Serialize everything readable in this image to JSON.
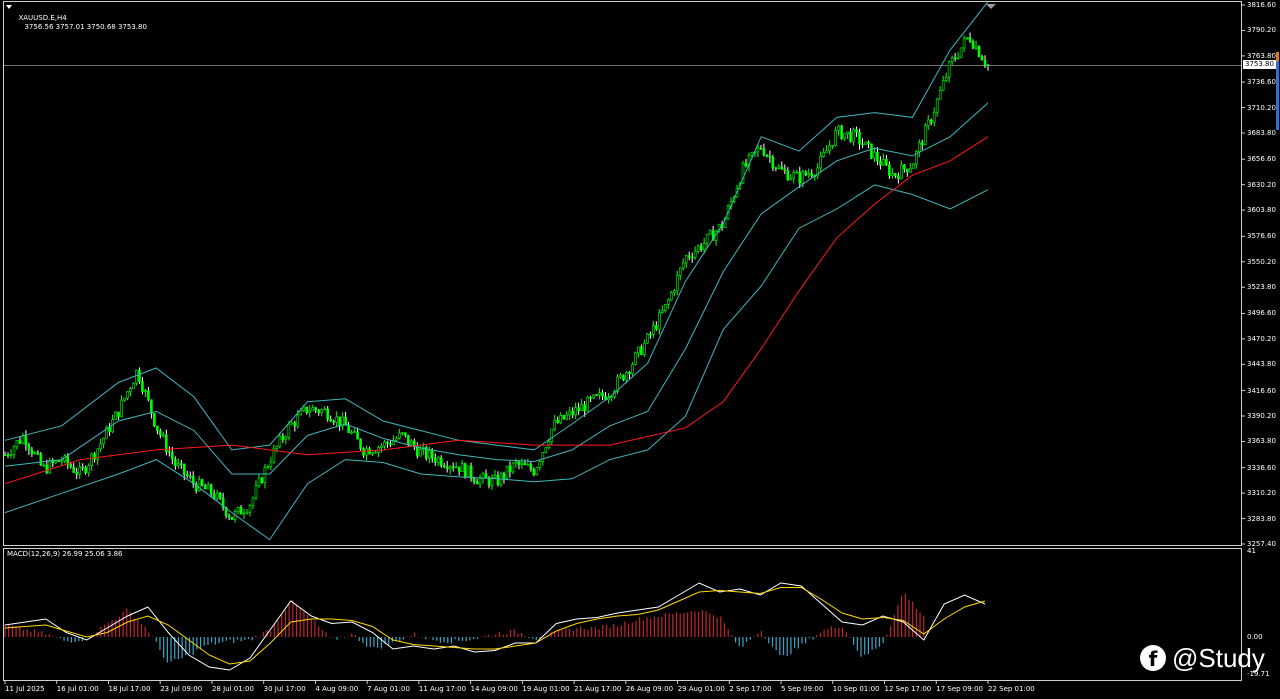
{
  "window": {
    "symbol_label": "XAUUSD.E,H4",
    "ohlc": "3756.56 3757.01 3750.68 3753.80"
  },
  "indicator": {
    "label": "MACD(12,26,9) 26.99 25.06 3.86",
    "axis": [
      "41",
      "0.00",
      "-19.71"
    ]
  },
  "price_axis": [
    "3816.60",
    "3790.20",
    "3763.80",
    "3736.60",
    "3710.20",
    "3683.80",
    "3656.60",
    "3630.20",
    "3603.80",
    "3576.60",
    "3550.20",
    "3523.80",
    "3496.60",
    "3470.20",
    "3443.80",
    "3416.60",
    "3390.20",
    "3363.80",
    "3336.60",
    "3310.20",
    "3283.80",
    "3257.40"
  ],
  "current_price": "3753.80",
  "time_axis": [
    "11 Jul 2025",
    "16 Jul 01:00",
    "18 Jul 17:00",
    "23 Jul 09:00",
    "28 Jul 01:00",
    "30 Jul 17:00",
    "4 Aug 09:00",
    "7 Aug 01:00",
    "11 Aug 17:00",
    "14 Aug 09:00",
    "19 Aug 01:00",
    "21 Aug 17:00",
    "26 Aug 09:00",
    "29 Aug 01:00",
    "2 Sep 17:00",
    "5 Sep 09:00",
    "10 Sep 01:00",
    "12 Sep 17:00",
    "17 Sep 09:00",
    "22 Sep 01:00"
  ],
  "watermark": {
    "icon": "facebook-icon",
    "text": "@Study"
  },
  "colors": {
    "bull_candle": "#00ff00",
    "bear_candle": "#ffffff",
    "bollinger": "#3fb6bd",
    "moving_average": "#ff1a1a",
    "macd_hist_pos": "#c0272d",
    "macd_hist_neg": "#3aa7c6",
    "macd_line": "#ffffff",
    "signal_line": "#ffd800"
  },
  "chart_data": {
    "type": "candlestick",
    "timeframe": "H4",
    "ylim": [
      3257.4,
      3816.6
    ],
    "close_path": [
      [
        0,
        3350
      ],
      [
        1,
        3370
      ],
      [
        2,
        3335
      ],
      [
        3,
        3345
      ],
      [
        4,
        3330
      ],
      [
        5,
        3360
      ],
      [
        6,
        3395
      ],
      [
        7,
        3438
      ],
      [
        8,
        3380
      ],
      [
        9,
        3340
      ],
      [
        10,
        3320
      ],
      [
        11,
        3310
      ],
      [
        12,
        3285
      ],
      [
        13,
        3300
      ],
      [
        14,
        3345
      ],
      [
        15,
        3378
      ],
      [
        16,
        3398
      ],
      [
        17,
        3395
      ],
      [
        18,
        3380
      ],
      [
        19,
        3355
      ],
      [
        20,
        3360
      ],
      [
        21,
        3370
      ],
      [
        22,
        3352
      ],
      [
        23,
        3345
      ],
      [
        24,
        3338
      ],
      [
        25,
        3325
      ],
      [
        26,
        3322
      ],
      [
        27,
        3340
      ],
      [
        28,
        3334
      ],
      [
        29,
        3380
      ],
      [
        30,
        3393
      ],
      [
        31,
        3405
      ],
      [
        32,
        3415
      ],
      [
        33,
        3440
      ],
      [
        34,
        3470
      ],
      [
        35,
        3505
      ],
      [
        36,
        3555
      ],
      [
        37,
        3570
      ],
      [
        38,
        3590
      ],
      [
        39,
        3645
      ],
      [
        40,
        3670
      ],
      [
        41,
        3645
      ],
      [
        42,
        3637
      ],
      [
        43,
        3648
      ],
      [
        44,
        3685
      ],
      [
        45,
        3680
      ],
      [
        46,
        3660
      ],
      [
        47,
        3640
      ],
      [
        48,
        3652
      ],
      [
        49,
        3700
      ],
      [
        50,
        3755
      ],
      [
        51,
        3785
      ],
      [
        52,
        3753.8
      ]
    ],
    "bb_upper": [
      [
        0,
        3365
      ],
      [
        3,
        3380
      ],
      [
        6,
        3425
      ],
      [
        8,
        3440
      ],
      [
        10,
        3410
      ],
      [
        12,
        3355
      ],
      [
        14,
        3360
      ],
      [
        16,
        3405
      ],
      [
        18,
        3408
      ],
      [
        20,
        3385
      ],
      [
        22,
        3375
      ],
      [
        24,
        3365
      ],
      [
        26,
        3360
      ],
      [
        28,
        3355
      ],
      [
        30,
        3382
      ],
      [
        32,
        3410
      ],
      [
        34,
        3445
      ],
      [
        36,
        3530
      ],
      [
        38,
        3590
      ],
      [
        40,
        3680
      ],
      [
        42,
        3665
      ],
      [
        44,
        3700
      ],
      [
        46,
        3705
      ],
      [
        48,
        3700
      ],
      [
        50,
        3770
      ],
      [
        52,
        3820
      ]
    ],
    "bb_mid": [
      [
        0,
        3338
      ],
      [
        3,
        3345
      ],
      [
        6,
        3385
      ],
      [
        8,
        3395
      ],
      [
        10,
        3375
      ],
      [
        12,
        3330
      ],
      [
        14,
        3330
      ],
      [
        16,
        3370
      ],
      [
        18,
        3382
      ],
      [
        20,
        3367
      ],
      [
        22,
        3357
      ],
      [
        24,
        3350
      ],
      [
        26,
        3345
      ],
      [
        28,
        3343
      ],
      [
        30,
        3355
      ],
      [
        32,
        3380
      ],
      [
        34,
        3395
      ],
      [
        36,
        3460
      ],
      [
        38,
        3540
      ],
      [
        40,
        3600
      ],
      [
        42,
        3628
      ],
      [
        44,
        3655
      ],
      [
        46,
        3668
      ],
      [
        48,
        3660
      ],
      [
        50,
        3680
      ],
      [
        52,
        3715
      ]
    ],
    "bb_lower": [
      [
        0,
        3290
      ],
      [
        3,
        3310
      ],
      [
        6,
        3330
      ],
      [
        8,
        3345
      ],
      [
        10,
        3320
      ],
      [
        12,
        3290
      ],
      [
        14,
        3262
      ],
      [
        16,
        3320
      ],
      [
        18,
        3345
      ],
      [
        20,
        3342
      ],
      [
        22,
        3330
      ],
      [
        24,
        3327
      ],
      [
        26,
        3325
      ],
      [
        28,
        3322
      ],
      [
        30,
        3325
      ],
      [
        32,
        3345
      ],
      [
        34,
        3355
      ],
      [
        36,
        3390
      ],
      [
        38,
        3480
      ],
      [
        40,
        3525
      ],
      [
        42,
        3585
      ],
      [
        44,
        3605
      ],
      [
        46,
        3630
      ],
      [
        48,
        3620
      ],
      [
        50,
        3605
      ],
      [
        52,
        3625
      ]
    ],
    "ma": [
      [
        0,
        3320
      ],
      [
        4,
        3345
      ],
      [
        8,
        3355
      ],
      [
        12,
        3360
      ],
      [
        16,
        3350
      ],
      [
        20,
        3355
      ],
      [
        24,
        3365
      ],
      [
        28,
        3360
      ],
      [
        32,
        3360
      ],
      [
        36,
        3378
      ],
      [
        38,
        3405
      ],
      [
        40,
        3460
      ],
      [
        42,
        3520
      ],
      [
        44,
        3575
      ],
      [
        46,
        3610
      ],
      [
        48,
        3640
      ],
      [
        50,
        3655
      ],
      [
        52,
        3680
      ]
    ],
    "macd_hist_path": [
      [
        0,
        8
      ],
      [
        2,
        2
      ],
      [
        3,
        -3
      ],
      [
        4,
        -1
      ],
      [
        5,
        9
      ],
      [
        6,
        18
      ],
      [
        7,
        5
      ],
      [
        8,
        -18
      ],
      [
        9,
        -12
      ],
      [
        10,
        -5
      ],
      [
        11,
        -3
      ],
      [
        12,
        -2
      ],
      [
        13,
        5
      ],
      [
        14,
        24
      ],
      [
        15,
        12
      ],
      [
        16,
        -2
      ],
      [
        17,
        2
      ],
      [
        18,
        -8
      ],
      [
        19,
        -4
      ],
      [
        20,
        2
      ],
      [
        21,
        -2
      ],
      [
        22,
        -3
      ],
      [
        23,
        -1
      ],
      [
        24,
        2
      ],
      [
        25,
        4
      ],
      [
        26,
        -1
      ],
      [
        27,
        3
      ],
      [
        28,
        6
      ],
      [
        29,
        6
      ],
      [
        30,
        8
      ],
      [
        31,
        12
      ],
      [
        32,
        14
      ],
      [
        33,
        16
      ],
      [
        34,
        18
      ],
      [
        35,
        14
      ],
      [
        36,
        -8
      ],
      [
        37,
        5
      ],
      [
        38,
        -14
      ],
      [
        39,
        -6
      ],
      [
        40,
        4
      ],
      [
        41,
        8
      ],
      [
        42,
        -14
      ],
      [
        43,
        -4
      ],
      [
        44,
        30
      ],
      [
        45,
        14
      ]
    ],
    "macd_line_path": [
      [
        0,
        8
      ],
      [
        2,
        12
      ],
      [
        3,
        3
      ],
      [
        4,
        -2
      ],
      [
        5,
        6
      ],
      [
        6,
        14
      ],
      [
        7,
        20
      ],
      [
        8,
        3
      ],
      [
        9,
        -12
      ],
      [
        10,
        -20
      ],
      [
        11,
        -22
      ],
      [
        12,
        -14
      ],
      [
        13,
        5
      ],
      [
        14,
        24
      ],
      [
        15,
        14
      ],
      [
        16,
        9
      ],
      [
        17,
        10
      ],
      [
        18,
        3
      ],
      [
        19,
        -8
      ],
      [
        20,
        -6
      ],
      [
        21,
        -8
      ],
      [
        22,
        -6
      ],
      [
        23,
        -10
      ],
      [
        24,
        -9
      ],
      [
        25,
        -4
      ],
      [
        26,
        -4
      ],
      [
        27,
        9
      ],
      [
        28,
        12
      ],
      [
        29,
        13
      ],
      [
        30,
        16
      ],
      [
        31,
        18
      ],
      [
        32,
        20
      ],
      [
        33,
        28
      ],
      [
        34,
        36
      ],
      [
        35,
        30
      ],
      [
        36,
        32
      ],
      [
        37,
        28
      ],
      [
        38,
        36
      ],
      [
        39,
        34
      ],
      [
        40,
        22
      ],
      [
        41,
        10
      ],
      [
        42,
        8
      ],
      [
        43,
        14
      ],
      [
        44,
        10
      ],
      [
        45,
        -2
      ],
      [
        46,
        22
      ],
      [
        47,
        28
      ],
      [
        48,
        22
      ]
    ],
    "signal_line_path": [
      [
        0,
        6
      ],
      [
        2,
        8
      ],
      [
        3,
        4
      ],
      [
        4,
        0
      ],
      [
        5,
        3
      ],
      [
        6,
        10
      ],
      [
        7,
        14
      ],
      [
        8,
        8
      ],
      [
        9,
        -2
      ],
      [
        10,
        -12
      ],
      [
        11,
        -18
      ],
      [
        12,
        -16
      ],
      [
        13,
        -4
      ],
      [
        14,
        10
      ],
      [
        15,
        12
      ],
      [
        16,
        12
      ],
      [
        17,
        11
      ],
      [
        18,
        7
      ],
      [
        19,
        -2
      ],
      [
        20,
        -5
      ],
      [
        21,
        -6
      ],
      [
        22,
        -7
      ],
      [
        23,
        -8
      ],
      [
        24,
        -8
      ],
      [
        25,
        -6
      ],
      [
        26,
        -4
      ],
      [
        27,
        4
      ],
      [
        28,
        9
      ],
      [
        29,
        12
      ],
      [
        30,
        14
      ],
      [
        31,
        15
      ],
      [
        32,
        18
      ],
      [
        33,
        24
      ],
      [
        34,
        30
      ],
      [
        35,
        31
      ],
      [
        36,
        30
      ],
      [
        37,
        29
      ],
      [
        38,
        33
      ],
      [
        39,
        33
      ],
      [
        40,
        25
      ],
      [
        41,
        16
      ],
      [
        42,
        12
      ],
      [
        43,
        13
      ],
      [
        44,
        11
      ],
      [
        45,
        2
      ],
      [
        46,
        12
      ],
      [
        47,
        20
      ],
      [
        48,
        24
      ]
    ]
  }
}
